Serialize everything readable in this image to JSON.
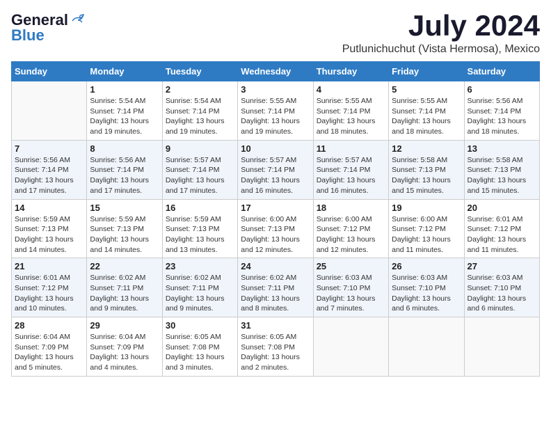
{
  "logo": {
    "general": "General",
    "blue": "Blue"
  },
  "title": {
    "month_year": "July 2024",
    "location": "Putlunichuchut (Vista Hermosa), Mexico"
  },
  "days_of_week": [
    "Sunday",
    "Monday",
    "Tuesday",
    "Wednesday",
    "Thursday",
    "Friday",
    "Saturday"
  ],
  "weeks": [
    [
      {
        "day": "",
        "info": ""
      },
      {
        "day": "1",
        "info": "Sunrise: 5:54 AM\nSunset: 7:14 PM\nDaylight: 13 hours\nand 19 minutes."
      },
      {
        "day": "2",
        "info": "Sunrise: 5:54 AM\nSunset: 7:14 PM\nDaylight: 13 hours\nand 19 minutes."
      },
      {
        "day": "3",
        "info": "Sunrise: 5:55 AM\nSunset: 7:14 PM\nDaylight: 13 hours\nand 19 minutes."
      },
      {
        "day": "4",
        "info": "Sunrise: 5:55 AM\nSunset: 7:14 PM\nDaylight: 13 hours\nand 18 minutes."
      },
      {
        "day": "5",
        "info": "Sunrise: 5:55 AM\nSunset: 7:14 PM\nDaylight: 13 hours\nand 18 minutes."
      },
      {
        "day": "6",
        "info": "Sunrise: 5:56 AM\nSunset: 7:14 PM\nDaylight: 13 hours\nand 18 minutes."
      }
    ],
    [
      {
        "day": "7",
        "info": "Sunrise: 5:56 AM\nSunset: 7:14 PM\nDaylight: 13 hours\nand 17 minutes."
      },
      {
        "day": "8",
        "info": "Sunrise: 5:56 AM\nSunset: 7:14 PM\nDaylight: 13 hours\nand 17 minutes."
      },
      {
        "day": "9",
        "info": "Sunrise: 5:57 AM\nSunset: 7:14 PM\nDaylight: 13 hours\nand 17 minutes."
      },
      {
        "day": "10",
        "info": "Sunrise: 5:57 AM\nSunset: 7:14 PM\nDaylight: 13 hours\nand 16 minutes."
      },
      {
        "day": "11",
        "info": "Sunrise: 5:57 AM\nSunset: 7:14 PM\nDaylight: 13 hours\nand 16 minutes."
      },
      {
        "day": "12",
        "info": "Sunrise: 5:58 AM\nSunset: 7:13 PM\nDaylight: 13 hours\nand 15 minutes."
      },
      {
        "day": "13",
        "info": "Sunrise: 5:58 AM\nSunset: 7:13 PM\nDaylight: 13 hours\nand 15 minutes."
      }
    ],
    [
      {
        "day": "14",
        "info": "Sunrise: 5:59 AM\nSunset: 7:13 PM\nDaylight: 13 hours\nand 14 minutes."
      },
      {
        "day": "15",
        "info": "Sunrise: 5:59 AM\nSunset: 7:13 PM\nDaylight: 13 hours\nand 14 minutes."
      },
      {
        "day": "16",
        "info": "Sunrise: 5:59 AM\nSunset: 7:13 PM\nDaylight: 13 hours\nand 13 minutes."
      },
      {
        "day": "17",
        "info": "Sunrise: 6:00 AM\nSunset: 7:13 PM\nDaylight: 13 hours\nand 12 minutes."
      },
      {
        "day": "18",
        "info": "Sunrise: 6:00 AM\nSunset: 7:12 PM\nDaylight: 13 hours\nand 12 minutes."
      },
      {
        "day": "19",
        "info": "Sunrise: 6:00 AM\nSunset: 7:12 PM\nDaylight: 13 hours\nand 11 minutes."
      },
      {
        "day": "20",
        "info": "Sunrise: 6:01 AM\nSunset: 7:12 PM\nDaylight: 13 hours\nand 11 minutes."
      }
    ],
    [
      {
        "day": "21",
        "info": "Sunrise: 6:01 AM\nSunset: 7:12 PM\nDaylight: 13 hours\nand 10 minutes."
      },
      {
        "day": "22",
        "info": "Sunrise: 6:02 AM\nSunset: 7:11 PM\nDaylight: 13 hours\nand 9 minutes."
      },
      {
        "day": "23",
        "info": "Sunrise: 6:02 AM\nSunset: 7:11 PM\nDaylight: 13 hours\nand 9 minutes."
      },
      {
        "day": "24",
        "info": "Sunrise: 6:02 AM\nSunset: 7:11 PM\nDaylight: 13 hours\nand 8 minutes."
      },
      {
        "day": "25",
        "info": "Sunrise: 6:03 AM\nSunset: 7:10 PM\nDaylight: 13 hours\nand 7 minutes."
      },
      {
        "day": "26",
        "info": "Sunrise: 6:03 AM\nSunset: 7:10 PM\nDaylight: 13 hours\nand 6 minutes."
      },
      {
        "day": "27",
        "info": "Sunrise: 6:03 AM\nSunset: 7:10 PM\nDaylight: 13 hours\nand 6 minutes."
      }
    ],
    [
      {
        "day": "28",
        "info": "Sunrise: 6:04 AM\nSunset: 7:09 PM\nDaylight: 13 hours\nand 5 minutes."
      },
      {
        "day": "29",
        "info": "Sunrise: 6:04 AM\nSunset: 7:09 PM\nDaylight: 13 hours\nand 4 minutes."
      },
      {
        "day": "30",
        "info": "Sunrise: 6:05 AM\nSunset: 7:08 PM\nDaylight: 13 hours\nand 3 minutes."
      },
      {
        "day": "31",
        "info": "Sunrise: 6:05 AM\nSunset: 7:08 PM\nDaylight: 13 hours\nand 2 minutes."
      },
      {
        "day": "",
        "info": ""
      },
      {
        "day": "",
        "info": ""
      },
      {
        "day": "",
        "info": ""
      }
    ]
  ]
}
